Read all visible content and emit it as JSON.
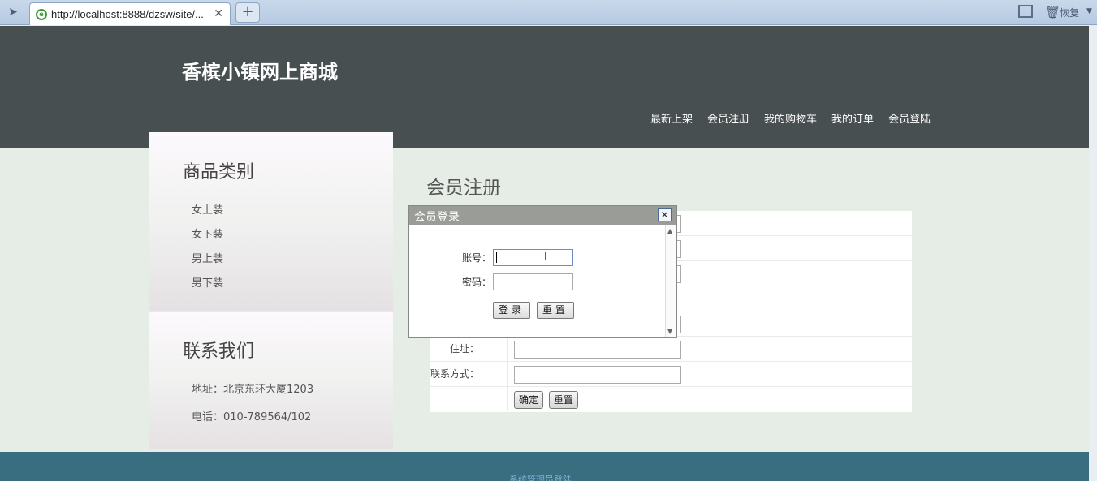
{
  "browser": {
    "tab_url": "http://localhost:8888/dzsw/site/...",
    "restore_label": "恢复"
  },
  "header": {
    "site_title": "香槟小镇网上商城",
    "nav": [
      "最新上架",
      "会员注册",
      "我的购物车",
      "我的订单",
      "会员登陆"
    ]
  },
  "sidebar": {
    "categories_title": "商品类别",
    "categories": [
      "女上装",
      "女下装",
      "男上装",
      "男下装"
    ],
    "contact_title": "联系我们",
    "address": "地址：北京东环大厦1203",
    "phone": "电话：010-789564/102"
  },
  "main": {
    "title": "会员注册",
    "address_label": "住址：",
    "contact_label": "联系方式：",
    "confirm_button": "确定",
    "reset_button": "重置"
  },
  "dialog": {
    "title": "会员登录",
    "account_label": "账号：",
    "password_label": "密码：",
    "login_button": "登录",
    "reset_button": "重置"
  },
  "footer": {
    "admin_link": "系统管理员登陆"
  }
}
